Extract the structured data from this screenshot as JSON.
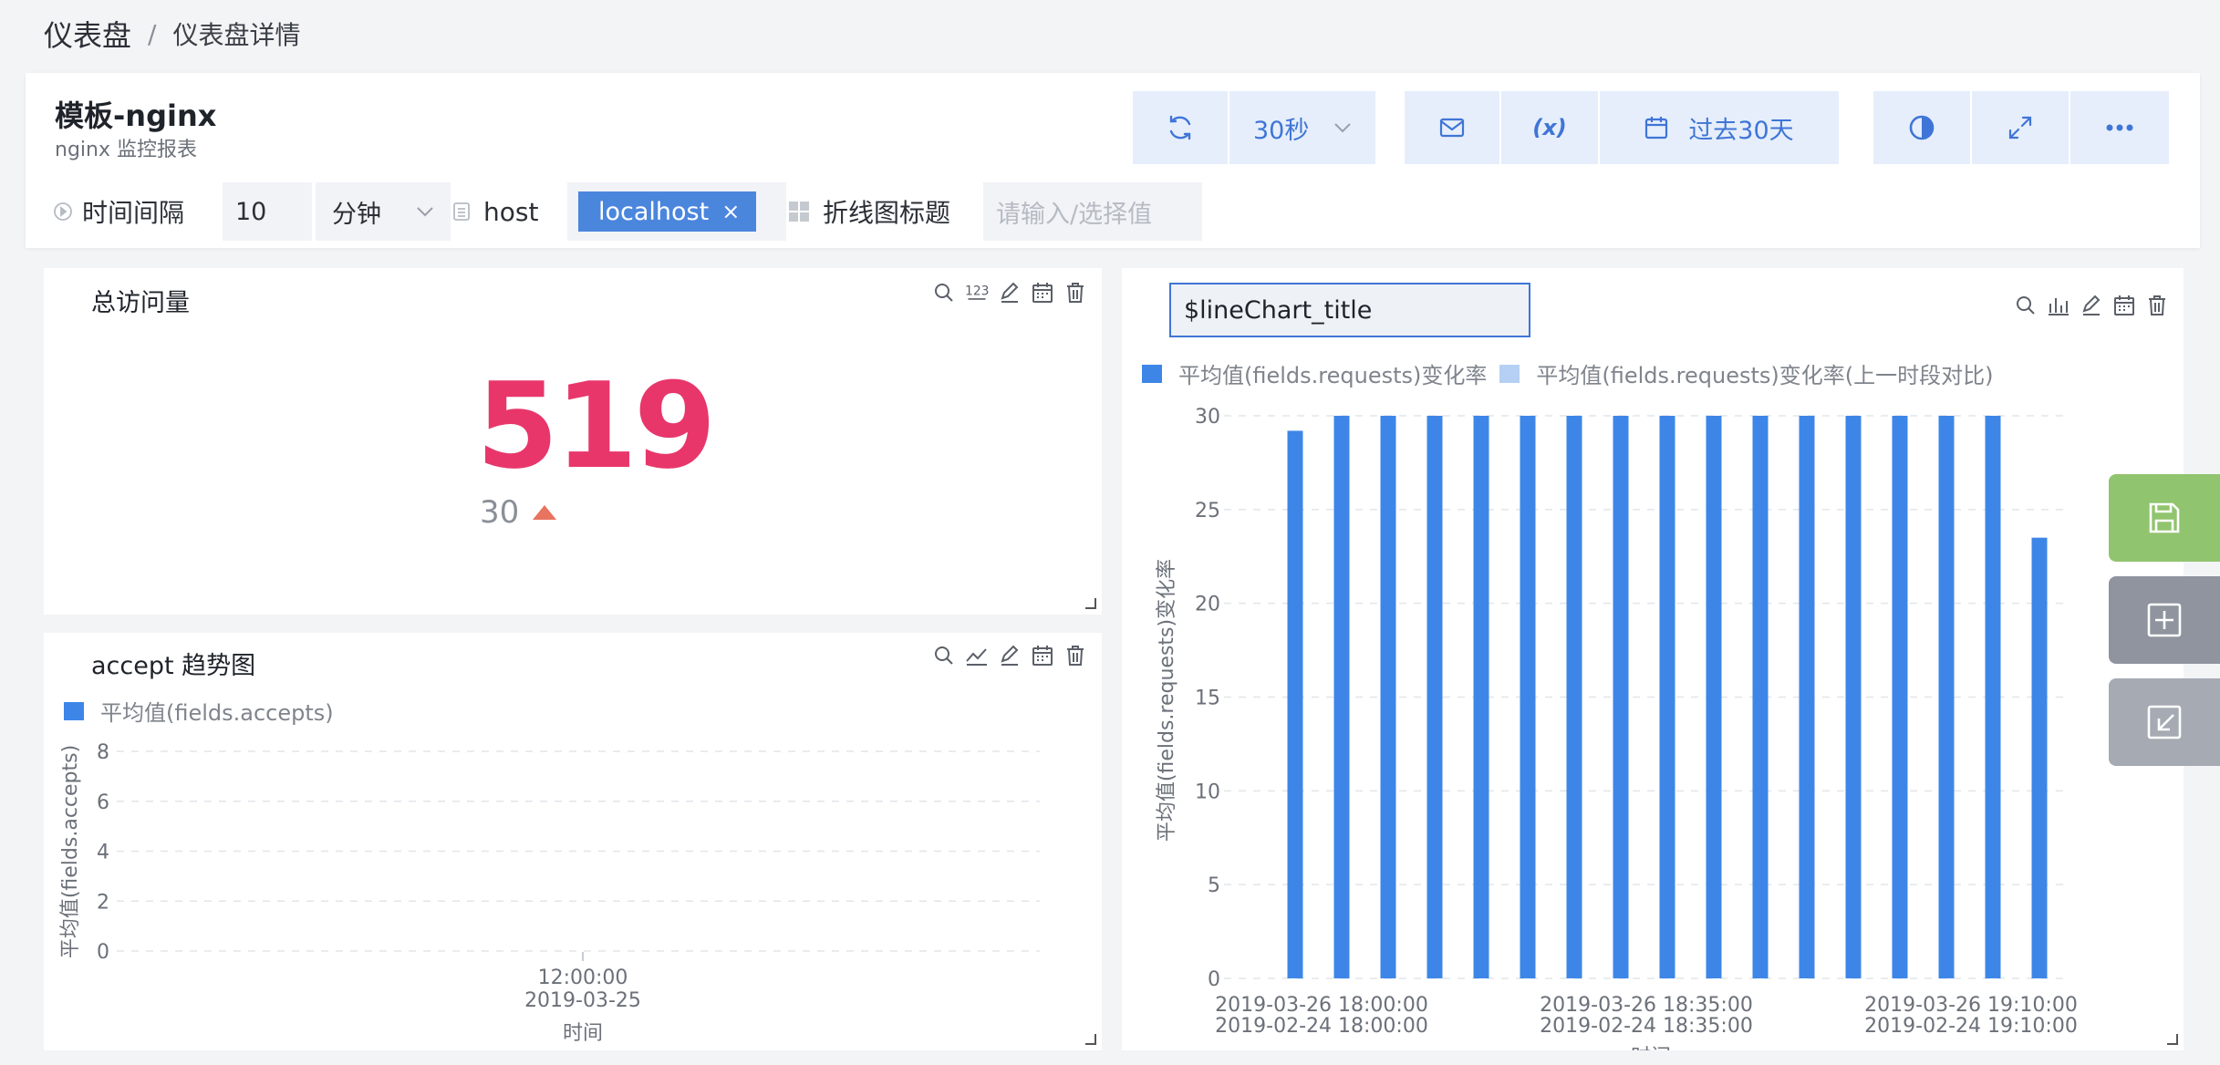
{
  "breadcrumb": {
    "root": "仪表盘",
    "separator": "/",
    "current": "仪表盘详情"
  },
  "header": {
    "title": "模板-nginx",
    "subtitle": "nginx 监控报表",
    "refresh_interval": "30秒",
    "variable_symbol": "(x)",
    "time_range": "过去30天"
  },
  "variables": {
    "interval_label": "时间间隔",
    "interval_value": "10",
    "interval_unit": "分钟",
    "host_label": "host",
    "host_tag": "localhost",
    "host_tag_close": "×",
    "linechart_title_label": "折线图标题",
    "linechart_title_placeholder": "请输入/选择值"
  },
  "panels": {
    "total": {
      "title": "总访问量",
      "value": "519",
      "compare_value": "30",
      "trend": "up",
      "trend_color": "#e8735f",
      "value_color": "#e8366b"
    },
    "accept": {
      "title": "accept 趋势图",
      "legend": "平均值(fields.accepts)",
      "ylabel": "平均值(fields.accepts)",
      "xlabel": "时间",
      "x_tick_line1": "12:00:00",
      "x_tick_line2": "2019-03-25"
    },
    "bar": {
      "title_input": "$lineChart_title",
      "legend1": "平均值(fields.requests)变化率",
      "legend2": "平均值(fields.requests)变化率(上一时段对比)",
      "ylabel": "平均值(fields.requests)变化率",
      "xlabel": "时间",
      "x_ticks": [
        {
          "l1": "2019-03-26 18:00:00",
          "l2": "2019-02-24 18:00:00"
        },
        {
          "l1": "2019-03-26 18:35:00",
          "l2": "2019-02-24 18:35:00"
        },
        {
          "l1": "2019-03-26 19:10:00",
          "l2": "2019-02-24 19:10:00"
        }
      ]
    }
  },
  "colors": {
    "accent": "#3f75d6",
    "bar_series": "#3d86e8",
    "bar_series_prev": "#b6d0f4",
    "side_save": "#91c46e",
    "side_add": "#8f949e",
    "side_import": "#a5aab3"
  },
  "chart_data": [
    {
      "type": "line",
      "title": "accept 趋势图",
      "xlabel": "时间",
      "ylabel": "平均值(fields.accepts)",
      "ylim": [
        0,
        8
      ],
      "y_ticks": [
        0,
        2,
        4,
        6,
        8
      ],
      "x_ticks": [
        "12:00:00 2019-03-25"
      ],
      "series": [
        {
          "name": "平均值(fields.accepts)",
          "values": []
        }
      ],
      "grid": true,
      "legend": "top-left"
    },
    {
      "type": "bar",
      "xlabel": "时间",
      "ylabel": "平均值(fields.requests)变化率",
      "ylim": [
        0,
        30
      ],
      "y_ticks": [
        0,
        5,
        10,
        15,
        20,
        25,
        30
      ],
      "series": [
        {
          "name": "平均值(fields.requests)变化率",
          "values": [
            29.2,
            30,
            30,
            30,
            30,
            30,
            30,
            30,
            30,
            30,
            30,
            30,
            30,
            30,
            30,
            30,
            23.5
          ]
        },
        {
          "name": "平均值(fields.requests)变化率(上一时段对比)",
          "values": []
        }
      ],
      "grid": true,
      "legend": "top-left"
    }
  ]
}
